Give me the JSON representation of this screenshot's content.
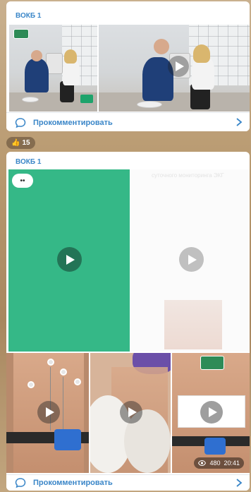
{
  "posts": [
    {
      "author": "ВОКБ 1",
      "comment_label": "Прокомментировать"
    },
    {
      "author": "ВОКБ 1",
      "reaction": {
        "emoji": "👍",
        "count": "15"
      },
      "emoji_bubble": "••",
      "ghost_caption": "суточного мониторинга ЭКГ",
      "video_views": "480",
      "post_time": "20:41",
      "comment_label": "Прокомментировать"
    }
  ],
  "colors": {
    "accent": "#3a86c8",
    "green_tile": "#35b887"
  },
  "icons": [
    "comment-icon",
    "chevron-right-icon",
    "play-icon",
    "eye-icon"
  ]
}
